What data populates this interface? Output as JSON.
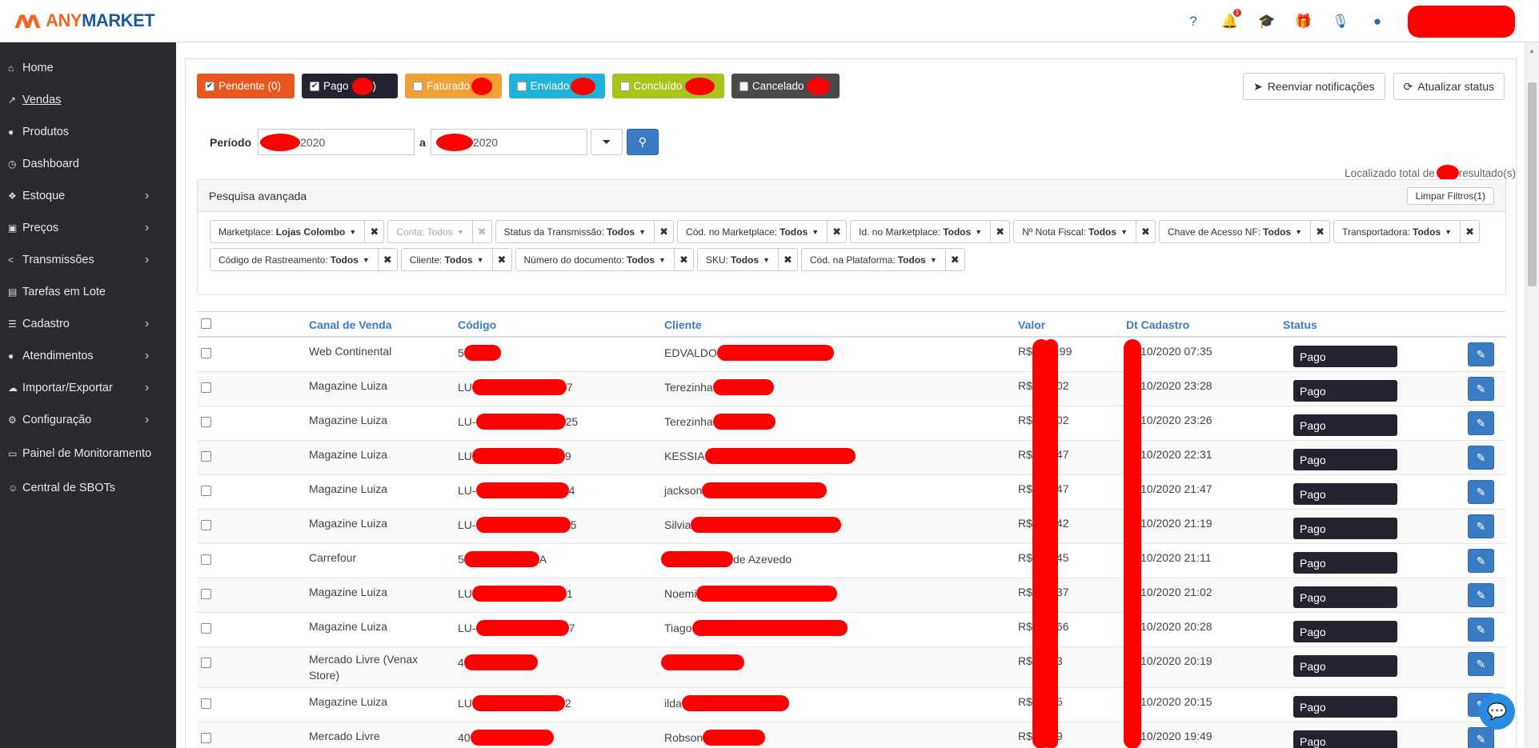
{
  "brand": {
    "logo_mark": "ʌʌ",
    "name_any": "ANY",
    "name_market": "MARKET"
  },
  "topbar": {
    "icons": [
      {
        "name": "help-icon",
        "glyph": "?"
      },
      {
        "name": "bell-icon",
        "glyph": "🔔",
        "badge": "1"
      },
      {
        "name": "graduation-cap-icon",
        "glyph": "🎓"
      },
      {
        "name": "gift-icon",
        "glyph": "🎁"
      },
      {
        "name": "microphone-slash-icon",
        "glyph": "🎙"
      },
      {
        "name": "globe-icon",
        "glyph": "●"
      }
    ]
  },
  "sidebar": {
    "items": [
      {
        "label": "Home",
        "icon": "⌂",
        "chevron": false
      },
      {
        "label": "Vendas",
        "icon": "↗",
        "chevron": false,
        "active": true
      },
      {
        "label": "Produtos",
        "icon": "●",
        "chevron": false
      },
      {
        "label": "Dashboard",
        "icon": "◷",
        "chevron": false
      },
      {
        "label": "Estoque",
        "icon": "❖",
        "chevron": true
      },
      {
        "label": "Preços",
        "icon": "▣",
        "chevron": true
      },
      {
        "label": "Transmissões",
        "icon": "<",
        "chevron": true
      },
      {
        "label": "Tarefas em Lote",
        "icon": "▤",
        "chevron": false
      },
      {
        "label": "Cadastro",
        "icon": "☰",
        "chevron": true
      },
      {
        "label": "Atendimentos",
        "icon": "●",
        "chevron": true
      },
      {
        "label": "Importar/Exportar",
        "icon": "☁",
        "chevron": true
      },
      {
        "label": "Configuração",
        "icon": "⚙",
        "chevron": true
      },
      {
        "label": "Painel de Monitoramento",
        "icon": "▭",
        "chevron": false
      },
      {
        "label": "Central de SBOTs",
        "icon": "☺",
        "chevron": false
      }
    ]
  },
  "filters": {
    "pendente": "Pendente (0)",
    "pago": "Pago",
    "pago_suffix": ")",
    "faturado": "Faturado",
    "enviado": "Enviado",
    "concluido": "Concluído",
    "cancelado": "Cancelado"
  },
  "actions": {
    "resend": "Reenviar notificações",
    "refresh": "Atualizar status"
  },
  "period": {
    "label": "Período",
    "from_value": "2020",
    "separator": "a",
    "to_value": "2020"
  },
  "total": {
    "prefix": "Localizado total de",
    "suffix": "resultado(s)"
  },
  "advanced": {
    "title": "Pesquisa avançada",
    "clear": "Limpar Filtros(1)",
    "chips": [
      {
        "label": "Marketplace:",
        "value": "Lojas Colombo",
        "muted": false
      },
      {
        "label": "Conta:",
        "value": "Todos",
        "muted": true
      },
      {
        "label": "Status da Transmissão:",
        "value": "Todos",
        "muted": false
      },
      {
        "label": "Cód. no Marketplace:",
        "value": "Todos",
        "muted": false
      },
      {
        "label": "Id. no Marketplace:",
        "value": "Todos",
        "muted": false
      },
      {
        "label": "Nº Nota Fiscal:",
        "value": "Todos",
        "muted": false
      },
      {
        "label": "Chave de Acesso NF:",
        "value": "Todos",
        "muted": false
      },
      {
        "label": "Transportadora:",
        "value": "Todos",
        "muted": false
      },
      {
        "label": "Código de Rastreamento:",
        "value": "Todos",
        "muted": false
      },
      {
        "label": "Cliente:",
        "value": "Todos",
        "muted": false
      },
      {
        "label": "Número do documento:",
        "value": "Todos",
        "muted": false
      },
      {
        "label": "SKU:",
        "value": "Todos",
        "muted": false
      },
      {
        "label": "Cód. na Plataforma:",
        "value": "Todos",
        "muted": false
      }
    ]
  },
  "table": {
    "headers": {
      "channel": "Canal de Venda",
      "code": "Código",
      "client": "Cliente",
      "value": "Valor",
      "date": "Dt Cadastro",
      "status": "Status"
    },
    "rows": [
      {
        "channel": "Web Continental",
        "code_pre": "5",
        "code_post": "",
        "client_pre": "EDVALDO",
        "client_post": "",
        "value_pre": "R$",
        "value_post": ".99",
        "date": "10/2020 07:35",
        "status": "Pago"
      },
      {
        "channel": "Magazine Luiza",
        "code_pre": "LU",
        "code_post": "7",
        "client_pre": "Terezinha",
        "client_post": "",
        "value_pre": "R$",
        "value_post": "02",
        "date": "10/2020 23:28",
        "status": "Pago"
      },
      {
        "channel": "Magazine Luiza",
        "code_pre": "LU-",
        "code_post": "25",
        "client_pre": "Terezinha",
        "client_post": "",
        "value_pre": "R$",
        "value_post": "02",
        "date": "10/2020 23:26",
        "status": "Pago"
      },
      {
        "channel": "Magazine Luiza",
        "code_pre": "LU",
        "code_post": "9",
        "client_pre": "KESSIA",
        "client_post": "",
        "value_pre": "R$",
        "value_post": "47",
        "date": "10/2020 22:31",
        "status": "Pago"
      },
      {
        "channel": "Magazine Luiza",
        "code_pre": "LU-",
        "code_post": "4",
        "client_pre": "jackson",
        "client_post": "",
        "value_pre": "R$",
        "value_post": "47",
        "date": "10/2020 21:47",
        "status": "Pago"
      },
      {
        "channel": "Magazine Luiza",
        "code_pre": "LU-",
        "code_post": "5",
        "client_pre": "Silvia",
        "client_post": "",
        "value_pre": "R$",
        "value_post": "42",
        "date": "10/2020 21:19",
        "status": "Pago"
      },
      {
        "channel": "Carrefour",
        "code_pre": "5",
        "code_post": "A",
        "client_pre": "",
        "client_post": "de Azevedo",
        "value_pre": "R$",
        "value_post": "45",
        "date": "10/2020 21:11",
        "status": "Pago"
      },
      {
        "channel": "Magazine Luiza",
        "code_pre": "LU",
        "code_post": "1",
        "client_pre": "Noemi",
        "client_post": "",
        "value_pre": "R$",
        "value_post": "37",
        "date": "10/2020 21:02",
        "status": "Pago"
      },
      {
        "channel": "Magazine Luiza",
        "code_pre": "LU-",
        "code_post": "7",
        "client_pre": "Tiago",
        "client_post": "",
        "value_pre": "R$",
        "value_post": "66",
        "date": "10/2020 20:28",
        "status": "Pago"
      },
      {
        "channel": "Mercado Livre (Venax Store)",
        "code_pre": "4",
        "code_post": "",
        "client_pre": "",
        "client_post": "",
        "value_pre": "R$",
        "value_post": "3",
        "date": "10/2020 20:19",
        "status": "Pago"
      },
      {
        "channel": "Magazine Luiza",
        "code_pre": "LU",
        "code_post": "2",
        "client_pre": "ilda",
        "client_post": "",
        "value_pre": "R$",
        "value_post": "5",
        "date": "10/2020 20:15",
        "status": "Pago"
      },
      {
        "channel": "Mercado Livre",
        "code_pre": "40",
        "code_post": "",
        "client_pre": "Robson",
        "client_post": "",
        "value_pre": "R$",
        "value_post": "9",
        "date": "10/2020 19:49",
        "status": "Pago"
      }
    ]
  },
  "colors": {
    "sidebar_bg": "#2a2b2e",
    "accent": "#3b7dc4",
    "brand_orange": "#f26522",
    "pendente": "#e8561f",
    "pago": "#23242f",
    "faturado": "#f0a035",
    "enviado": "#1fb3d8",
    "concluido": "#a7c41b",
    "cancelado": "#4a4a4a"
  }
}
